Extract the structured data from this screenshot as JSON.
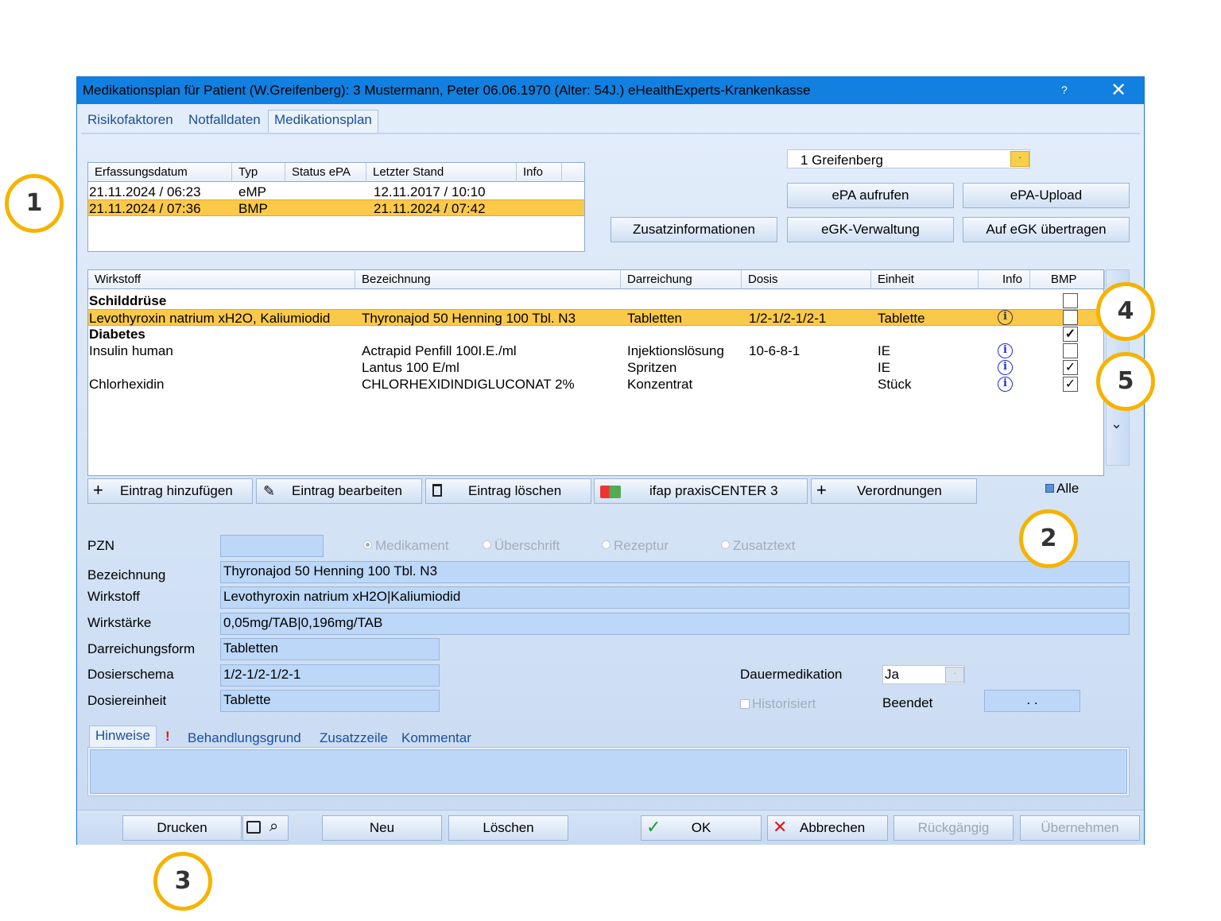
{
  "window": {
    "title": "Medikationsplan für Patient (W.Greifenberg): 3  Mustermann, Peter 06.06.1970  (Alter: 54J.)  eHealthExperts-Krankenkasse",
    "help": "?",
    "close": "✕"
  },
  "tabs": [
    "Risikofaktoren",
    "Notfalldaten",
    "Medikationsplan"
  ],
  "plans": {
    "headers": [
      "Erfassungsdatum",
      "Typ",
      "Status ePA",
      "Letzter Stand",
      "Info"
    ],
    "rows": [
      {
        "date": "21.11.2024 / 06:23",
        "typ": "eMP",
        "status": "",
        "stand": "12.11.2017 / 10:10"
      },
      {
        "date": "21.11.2024 / 07:36",
        "typ": "BMP",
        "status": "",
        "stand": "21.11.2024 / 07:42"
      }
    ]
  },
  "doctor_select": "1 Greifenberg",
  "buttons": {
    "epa_aufrufen": "ePA aufrufen",
    "epa_upload": "ePA-Upload",
    "zusatzinfo": "Zusatzinformationen",
    "egk_verwaltung": "eGK-Verwaltung",
    "auf_egk": "Auf eGK übertragen",
    "eintrag_hinzu": "Eintrag hinzufügen",
    "eintrag_bearb": "Eintrag bearbeiten",
    "eintrag_loeschen": "Eintrag löschen",
    "ifap": "ifap praxisCENTER 3",
    "verordnungen": "Verordnungen",
    "alle": "Alle",
    "drucken": "Drucken",
    "neu": "Neu",
    "loeschen": "Löschen",
    "ok": "OK",
    "abbrechen": "Abbrechen",
    "rueckgaengig": "Rückgängig",
    "uebernehmen": "Übernehmen"
  },
  "meds": {
    "headers": [
      "Wirkstoff",
      "Bezeichnung",
      "Darreichung",
      "Dosis",
      "Einheit",
      "Info",
      "BMP"
    ],
    "rows": [
      {
        "wirkstoff": "Schilddrüse",
        "heading": true,
        "bmp": false
      },
      {
        "wirkstoff": "Levothyroxin natrium xH2O, Kaliumiodid",
        "bez": "Thyronajod 50 Henning 100 Tbl. N3",
        "darr": "Tabletten",
        "dosis": "1/2-1/2-1/2-1",
        "einheit": "Tablette",
        "info": true,
        "bmp": false,
        "selected": true
      },
      {
        "wirkstoff": "Diabetes",
        "heading": true,
        "bmp": true
      },
      {
        "wirkstoff": "Insulin human",
        "bez": "Actrapid Penfill 100I.E./ml",
        "darr": "Injektionslösung",
        "dosis": "10-6-8-1",
        "einheit": "IE",
        "info": true,
        "bmp": false
      },
      {
        "wirkstoff": "",
        "bez": "Lantus 100 E/ml",
        "darr": "Spritzen",
        "dosis": "",
        "einheit": "IE",
        "info": true,
        "bmp": true
      },
      {
        "wirkstoff": "Chlorhexidin",
        "bez": "CHLORHEXIDINDIGLUCONAT 2%",
        "darr": "Konzentrat",
        "dosis": "",
        "einheit": "Stück",
        "info": true,
        "bmp": true
      }
    ]
  },
  "form": {
    "pzn_label": "PZN",
    "pzn_value": "",
    "radios": [
      "Medikament",
      "Überschrift",
      "Rezeptur",
      "Zusatztext"
    ],
    "bez_label": "Bezeichnung",
    "bez_value": "Thyronajod 50 Henning 100 Tbl. N3",
    "wirkstoff_label": "Wirkstoff",
    "wirkstoff_value": "Levothyroxin natrium xH2O|Kaliumiodid",
    "staerke_label": "Wirkstärke",
    "staerke_value": "0,05mg/TAB|0,196mg/TAB",
    "darr_label": "Darreichungsform",
    "darr_value": "Tabletten",
    "dosier_label": "Dosierschema",
    "dosier_value": "1/2-1/2-1/2-1",
    "einheit_label": "Dosiereinheit",
    "einheit_value": "Tablette",
    "dauer_label": "Dauermedikation",
    "dauer_value": "Ja",
    "historisiert_label": "Historisiert",
    "beendet_label": "Beendet",
    "beendet_value": ".   ."
  },
  "subtabs": [
    "Hinweise",
    "!",
    "Behandlungsgrund",
    "Zusatzzeile",
    "Kommentar"
  ],
  "callouts": [
    "1",
    "2",
    "3",
    "4",
    "5"
  ]
}
